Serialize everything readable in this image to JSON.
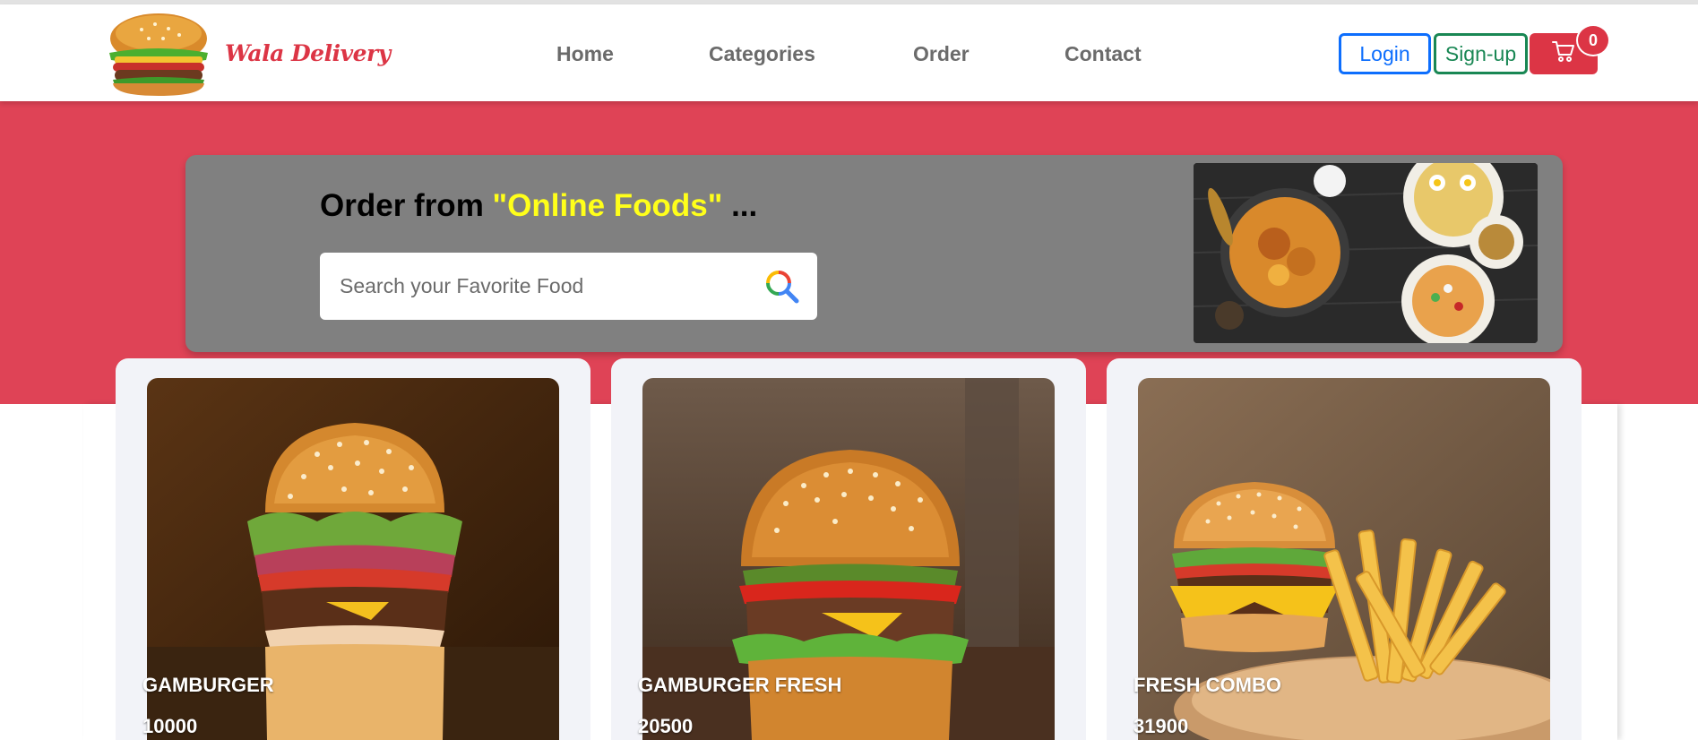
{
  "brand": {
    "name": "Wala Delivery",
    "logo_icon": "burger-logo-icon"
  },
  "nav": {
    "items": [
      {
        "label": "Home"
      },
      {
        "label": "Categories"
      },
      {
        "label": "Order"
      },
      {
        "label": "Contact"
      }
    ]
  },
  "auth": {
    "login_label": "Login",
    "signup_label": "Sign-up"
  },
  "cart": {
    "count": "0",
    "icon": "cart-icon"
  },
  "hero": {
    "headline_prefix": "Order from ",
    "headline_highlight": "\"Online Foods\"",
    "headline_suffix": " ...",
    "search_placeholder": "Search your Favorite Food",
    "search_icon": "search-icon"
  },
  "products": [
    {
      "name": "GAMBURGER",
      "price": "10000"
    },
    {
      "name": "GAMBURGER FRESH",
      "price": "20500"
    },
    {
      "name": "FRESH COMBO",
      "price": "31900"
    }
  ],
  "colors": {
    "accent_red": "#dc3545",
    "hero_red": "#df4356",
    "banner_gray": "#808080",
    "highlight_yellow": "#ffff1a",
    "login_blue": "#0d6efd",
    "signup_green": "#198754"
  }
}
